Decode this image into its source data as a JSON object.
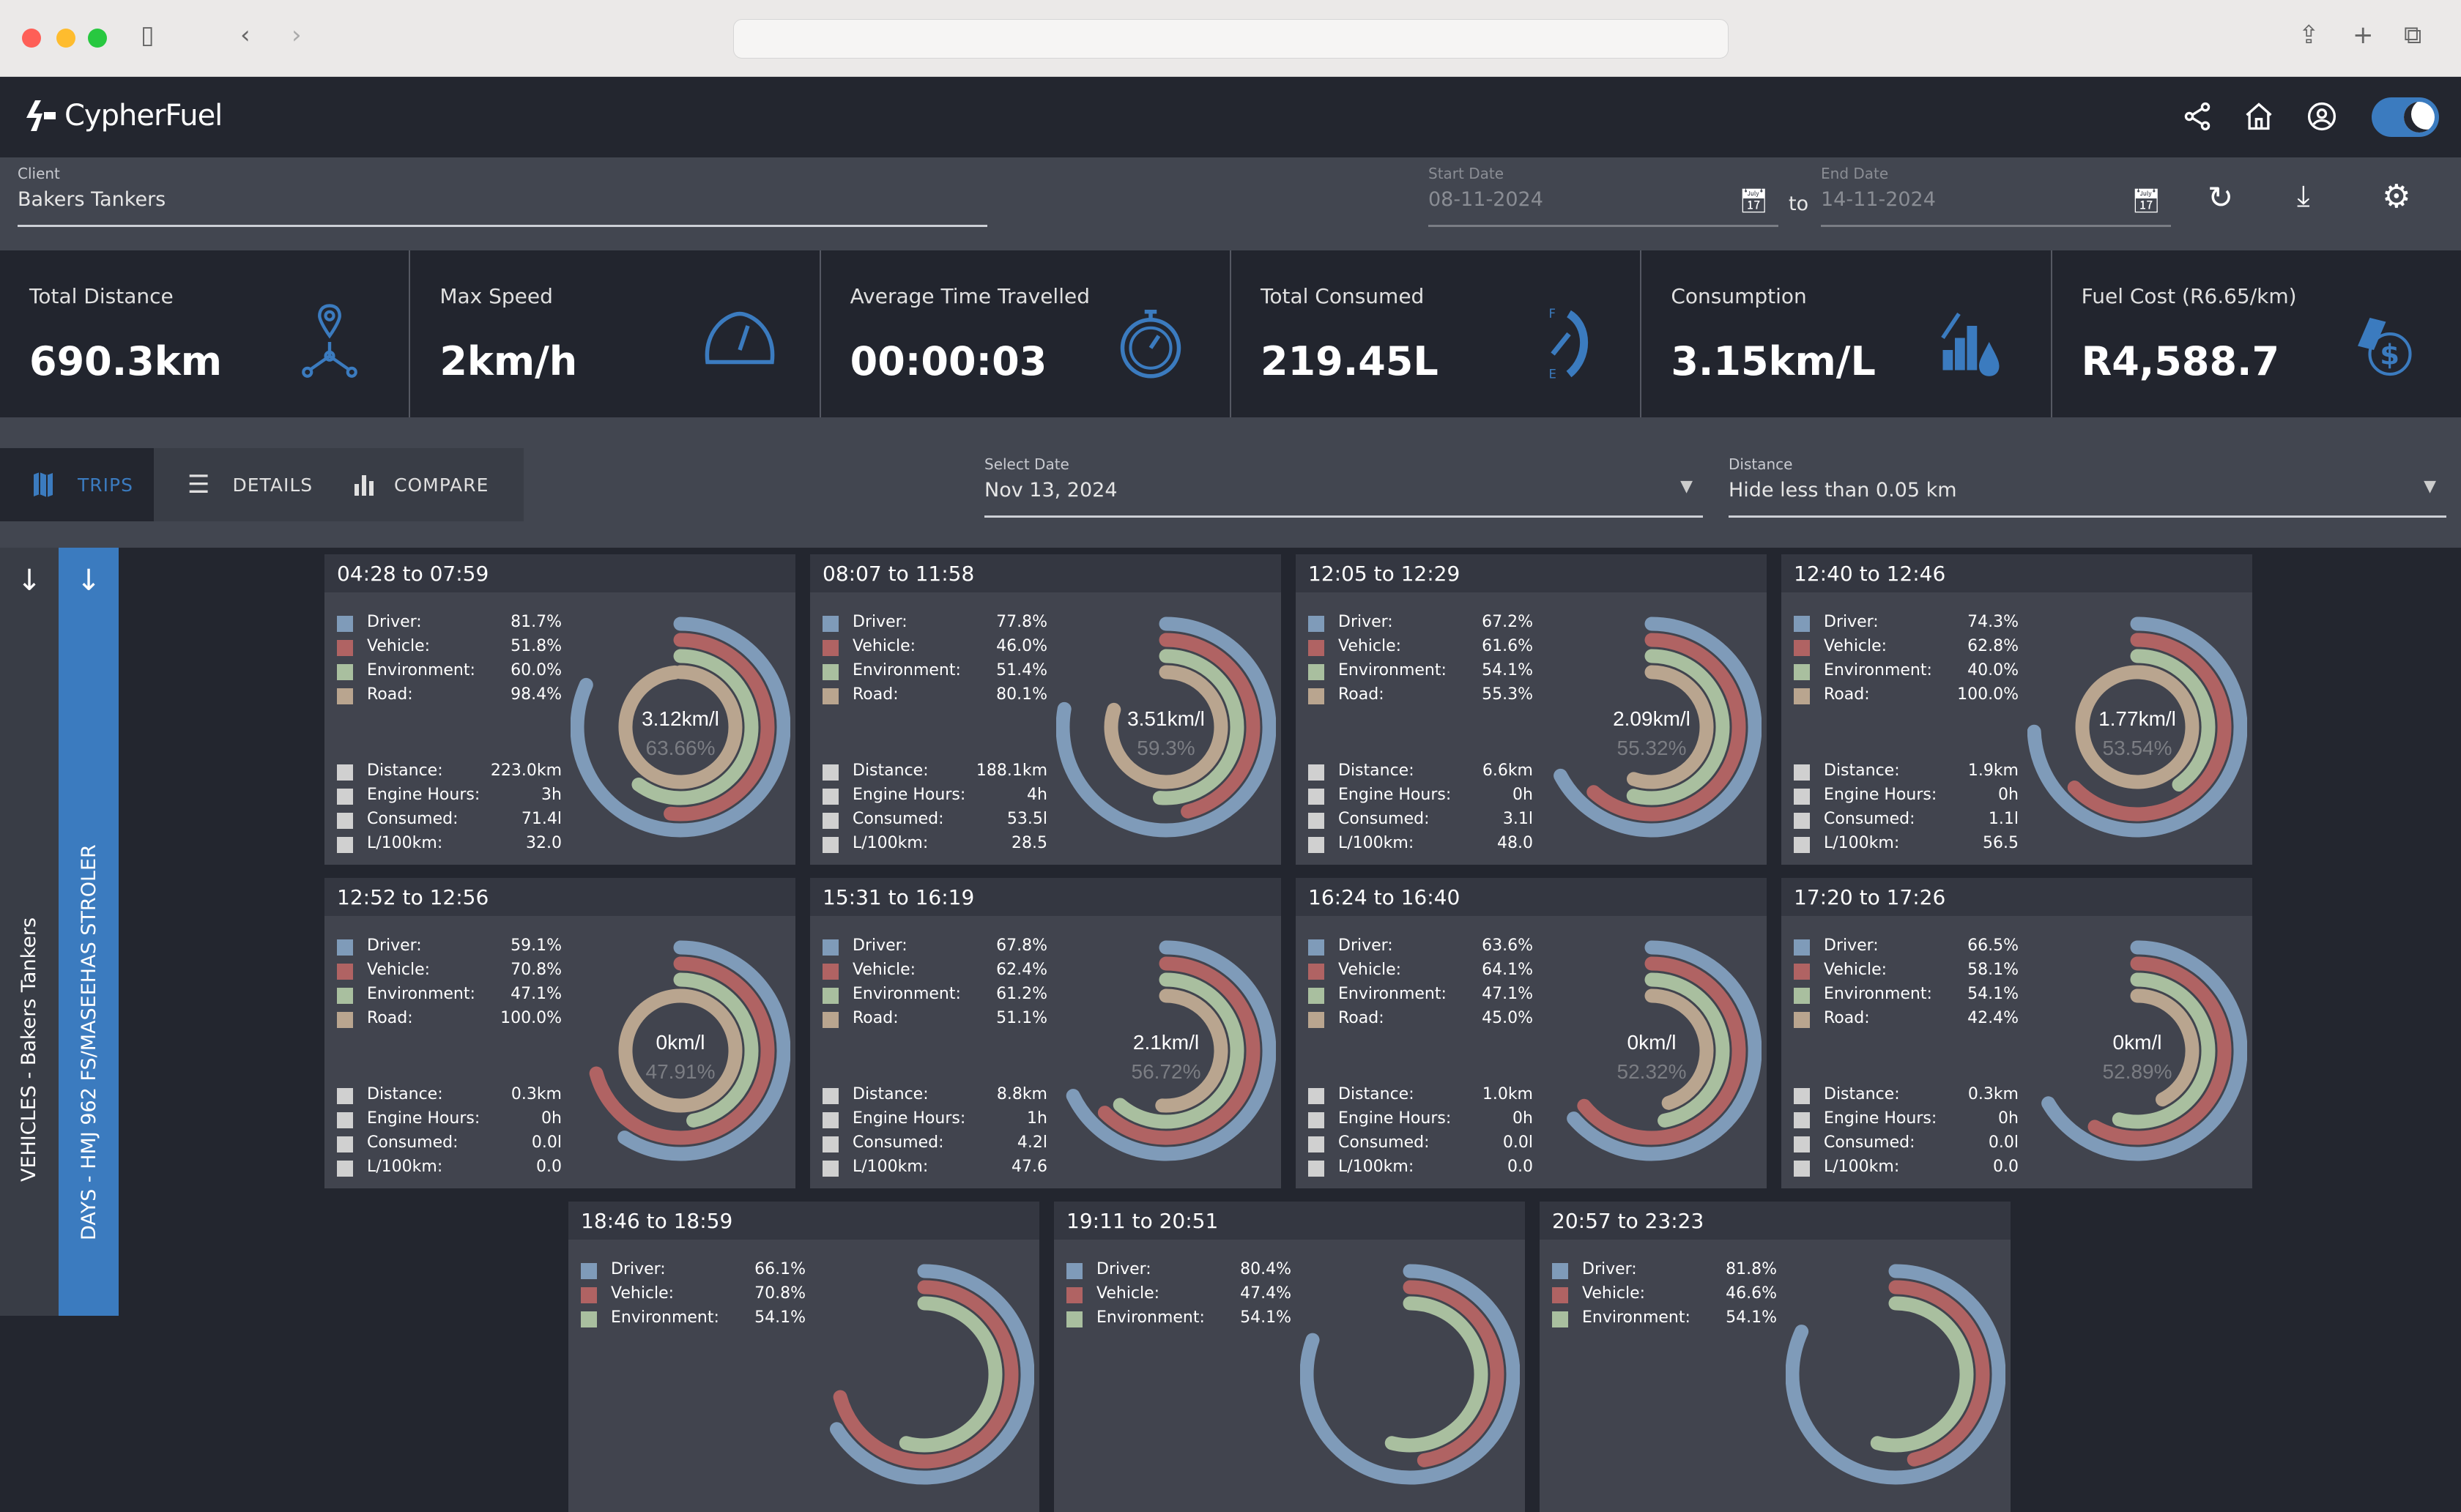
{
  "app": {
    "name": "CypherFuel"
  },
  "filters": {
    "client_label": "Client",
    "client_value": "Bakers Tankers",
    "start_label": "Start Date",
    "start_value": "08-11-2024",
    "to": "to",
    "end_label": "End Date",
    "end_value": "14-11-2024"
  },
  "kpis": [
    {
      "title": "Total Distance",
      "value": "690.3km",
      "icon": "route-pin-icon"
    },
    {
      "title": "Max Speed",
      "value": "2km/h",
      "icon": "speedometer-icon"
    },
    {
      "title": "Average Time Travelled",
      "value": "00:00:03",
      "icon": "stopwatch-icon"
    },
    {
      "title": "Total Consumed",
      "value": "219.45L",
      "icon": "fuel-gauge-icon"
    },
    {
      "title": "Consumption",
      "value": "3.15km/L",
      "icon": "chart-drop-icon"
    },
    {
      "title": "Fuel Cost (R6.65/km)",
      "value": "R4,588.7",
      "icon": "fuel-nozzle-dollar-icon"
    }
  ],
  "tabs": [
    {
      "label": "TRIPS",
      "active": true
    },
    {
      "label": "DETAILS"
    },
    {
      "label": "COMPARE"
    }
  ],
  "select_date": {
    "label": "Select Date",
    "value": "Nov 13, 2024"
  },
  "distance_filter": {
    "label": "Distance",
    "value": "Hide less than 0.05 km"
  },
  "side": {
    "vehicles": "VEHICLES - Bakers Tankers",
    "days": "DAYS - HMJ 962 FS/MASEEHAS STROLER"
  },
  "labels": {
    "driver": "Driver:",
    "vehicle": "Vehicle:",
    "environment": "Environment:",
    "road": "Road:",
    "distance": "Distance:",
    "engine_hours": "Engine Hours:",
    "consumed": "Consumed:",
    "l100": "L/100km:"
  },
  "colors": {
    "driver": "#7f9bb9",
    "vehicle": "#b06363",
    "environment": "#a9bf9f",
    "road": "#b9a58f",
    "accent": "#3b7bbf"
  },
  "chart_data": {
    "type": "radial-bar",
    "series": [
      "driver",
      "vehicle",
      "environment",
      "road"
    ],
    "trips": [
      {
        "time": "04:28 to 07:59",
        "driver": "81.7%",
        "vehicle": "51.8%",
        "environment": "60.0%",
        "road": "98.4%",
        "distance": "223.0km",
        "engine_hours": "3h",
        "consumed": "71.4l",
        "l100": "32.0",
        "kml": "3.12km/l",
        "pct": "63.66%"
      },
      {
        "time": "08:07 to 11:58",
        "driver": "77.8%",
        "vehicle": "46.0%",
        "environment": "51.4%",
        "road": "80.1%",
        "distance": "188.1km",
        "engine_hours": "4h",
        "consumed": "53.5l",
        "l100": "28.5",
        "kml": "3.51km/l",
        "pct": "59.3%"
      },
      {
        "time": "12:05 to 12:29",
        "driver": "67.2%",
        "vehicle": "61.6%",
        "environment": "54.1%",
        "road": "55.3%",
        "distance": "6.6km",
        "engine_hours": "0h",
        "consumed": "3.1l",
        "l100": "48.0",
        "kml": "2.09km/l",
        "pct": "55.32%"
      },
      {
        "time": "12:40 to 12:46",
        "driver": "74.3%",
        "vehicle": "62.8%",
        "environment": "40.0%",
        "road": "100.0%",
        "distance": "1.9km",
        "engine_hours": "0h",
        "consumed": "1.1l",
        "l100": "56.5",
        "kml": "1.77km/l",
        "pct": "53.54%"
      },
      {
        "time": "12:52 to 12:56",
        "driver": "59.1%",
        "vehicle": "70.8%",
        "environment": "47.1%",
        "road": "100.0%",
        "distance": "0.3km",
        "engine_hours": "0h",
        "consumed": "0.0l",
        "l100": "0.0",
        "kml": "0km/l",
        "pct": "47.91%"
      },
      {
        "time": "15:31 to 16:19",
        "driver": "67.8%",
        "vehicle": "62.4%",
        "environment": "61.2%",
        "road": "51.1%",
        "distance": "8.8km",
        "engine_hours": "1h",
        "consumed": "4.2l",
        "l100": "47.6",
        "kml": "2.1km/l",
        "pct": "56.72%"
      },
      {
        "time": "16:24 to 16:40",
        "driver": "63.6%",
        "vehicle": "64.1%",
        "environment": "47.1%",
        "road": "45.0%",
        "distance": "1.0km",
        "engine_hours": "0h",
        "consumed": "0.0l",
        "l100": "0.0",
        "kml": "0km/l",
        "pct": "52.32%"
      },
      {
        "time": "17:20 to 17:26",
        "driver": "66.5%",
        "vehicle": "58.1%",
        "environment": "54.1%",
        "road": "42.4%",
        "distance": "0.3km",
        "engine_hours": "0h",
        "consumed": "0.0l",
        "l100": "0.0",
        "kml": "0km/l",
        "pct": "52.89%"
      },
      {
        "time": "18:46 to 18:59",
        "driver": "66.1%",
        "vehicle": "70.8%",
        "environment": "54.1%"
      },
      {
        "time": "19:11 to 20:51",
        "driver": "80.4%",
        "vehicle": "47.4%",
        "environment": "54.1%"
      },
      {
        "time": "20:57 to 23:23",
        "driver": "81.8%",
        "vehicle": "46.6%",
        "environment": "54.1%"
      }
    ]
  }
}
